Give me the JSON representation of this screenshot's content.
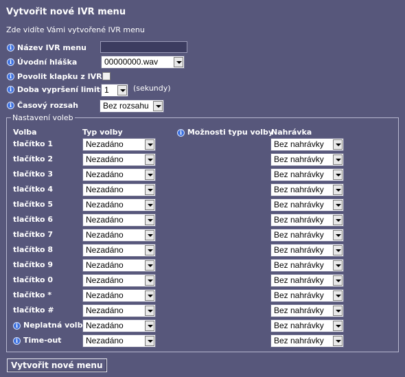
{
  "title": "Vytvořit nové IVR menu",
  "subtitle": "Zde vidíte Vámi vytvořené IVR menu",
  "info_glyph": "i",
  "form": {
    "name_label": "Název IVR menu",
    "name_value": "",
    "greeting_label": "Úvodní hláška",
    "greeting_value": "00000000.wav",
    "flap_label": "Povolit klapku z IVR",
    "flap_checked": false,
    "timeout_label": "Doba vypršení limitu",
    "timeout_value": "1",
    "timeout_unit": "(sekundy)",
    "timerange_label": "Časový rozsah",
    "timerange_value": "Bez rozsahu"
  },
  "options": {
    "legend": "Nastavení voleb",
    "headers": {
      "choice": "Volba",
      "type": "Typ volby",
      "type_options": "Možnosti typu volby",
      "recording": "Nahrávka"
    },
    "rows": [
      {
        "label": "tlačítko 1",
        "info": false,
        "type": "Nezadáno",
        "recording": "Bez nahrávky"
      },
      {
        "label": "tlačítko 2",
        "info": false,
        "type": "Nezadáno",
        "recording": "Bez nahrávky"
      },
      {
        "label": "tlačítko 3",
        "info": false,
        "type": "Nezadáno",
        "recording": "Bez nahrávky"
      },
      {
        "label": "tlačítko 4",
        "info": false,
        "type": "Nezadáno",
        "recording": "Bez nahrávky"
      },
      {
        "label": "tlačítko 5",
        "info": false,
        "type": "Nezadáno",
        "recording": "Bez nahrávky"
      },
      {
        "label": "tlačítko 6",
        "info": false,
        "type": "Nezadáno",
        "recording": "Bez nahrávky"
      },
      {
        "label": "tlačítko 7",
        "info": false,
        "type": "Nezadáno",
        "recording": "Bez nahrávky"
      },
      {
        "label": "tlačítko 8",
        "info": false,
        "type": "Nezadáno",
        "recording": "Bez nahrávky"
      },
      {
        "label": "tlačítko 9",
        "info": false,
        "type": "Nezadáno",
        "recording": "Bez nahrávky"
      },
      {
        "label": "tlačítko 0",
        "info": false,
        "type": "Nezadáno",
        "recording": "Bez nahrávky"
      },
      {
        "label": "tlačítko *",
        "info": false,
        "type": "Nezadáno",
        "recording": "Bez nahrávky"
      },
      {
        "label": "tlačítko #",
        "info": false,
        "type": "Nezadáno",
        "recording": "Bez nahrávky"
      },
      {
        "label": "Neplatná volba",
        "info": true,
        "type": "Nezadáno",
        "recording": "Bez nahrávky"
      },
      {
        "label": "Time-out",
        "info": true,
        "type": "Nezadáno",
        "recording": "Bez nahrávky"
      }
    ]
  },
  "submit_label": "Vytvořit nové menu"
}
